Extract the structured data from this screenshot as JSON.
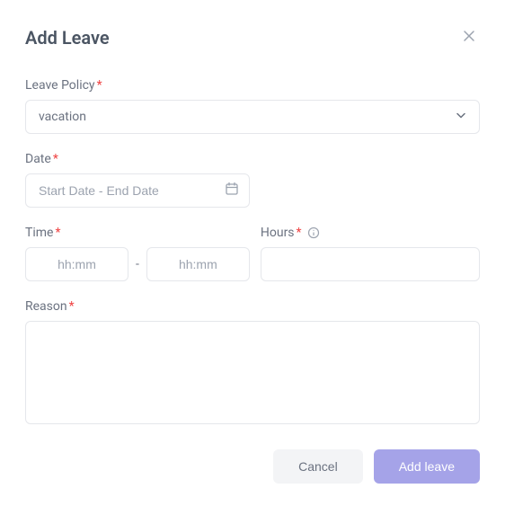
{
  "header": {
    "title": "Add Leave"
  },
  "form": {
    "leavePolicy": {
      "label": "Leave Policy",
      "value": "vacation"
    },
    "date": {
      "label": "Date",
      "placeholder": "Start Date - End Date"
    },
    "time": {
      "label": "Time",
      "startPlaceholder": "hh:mm",
      "endPlaceholder": "hh:mm",
      "separator": "-"
    },
    "hours": {
      "label": "Hours"
    },
    "reason": {
      "label": "Reason"
    }
  },
  "footer": {
    "cancel": "Cancel",
    "submit": "Add leave"
  }
}
